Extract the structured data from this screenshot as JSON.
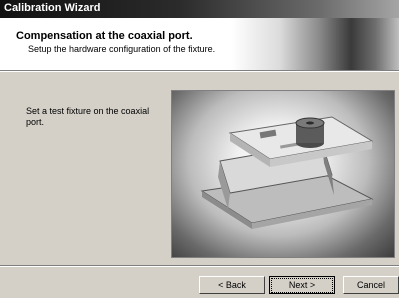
{
  "window": {
    "title": "Calibration Wizard"
  },
  "header": {
    "title": "Compensation at the coaxial port.",
    "subtitle": "Setup the hardware configuration of the fixture."
  },
  "main": {
    "instruction": "Set a test fixture on the coaxial port.",
    "image_subject": "test fixture photo"
  },
  "buttons": {
    "back_label": "< Back",
    "next_label": "Next >",
    "cancel_label": "Cancel"
  }
}
